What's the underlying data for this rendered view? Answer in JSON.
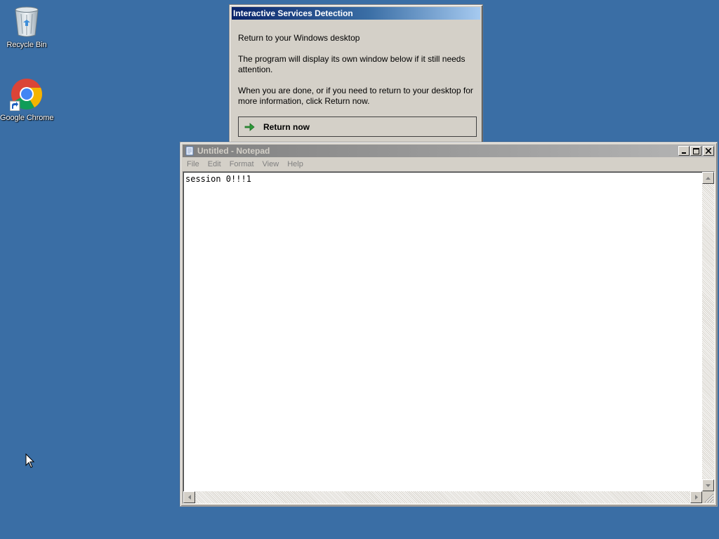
{
  "desktop": {
    "background_color": "#3a6ea5",
    "icons": [
      {
        "label": "Recycle Bin",
        "icon": "recycle-bin-icon"
      },
      {
        "label": "Google Chrome",
        "icon": "chrome-icon"
      }
    ]
  },
  "isd_dialog": {
    "title": "Interactive Services Detection",
    "heading": "Return to your Windows desktop",
    "paragraph1": "The program will display its own window below if it still needs attention.",
    "paragraph2": "When you are done, or if you need to return to your desktop for more information, click Return now.",
    "return_button_label": "Return now",
    "return_button_icon": "green-arrow-right-icon"
  },
  "notepad": {
    "title": "Untitled - Notepad",
    "menu": [
      "File",
      "Edit",
      "Format",
      "View",
      "Help"
    ],
    "content": "session 0!!!1",
    "window_buttons": [
      "minimize-icon",
      "maximize-icon",
      "close-icon"
    ]
  }
}
